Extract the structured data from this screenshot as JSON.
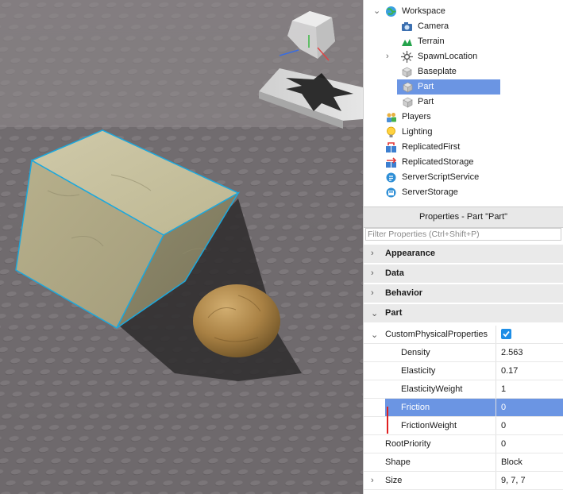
{
  "explorer": {
    "items": [
      {
        "label": "Workspace",
        "icon": "workspace-globe-icon",
        "expanded": true
      },
      {
        "label": "Camera",
        "icon": "camera-icon"
      },
      {
        "label": "Terrain",
        "icon": "terrain-icon"
      },
      {
        "label": "SpawnLocation",
        "icon": "spawn-location-icon",
        "collapsed_expander": true
      },
      {
        "label": "Baseplate",
        "icon": "part-block-icon"
      },
      {
        "label": "Part",
        "icon": "part-block-icon",
        "selected": true
      },
      {
        "label": "Part",
        "icon": "part-block-icon"
      },
      {
        "label": "Players",
        "icon": "players-icon"
      },
      {
        "label": "Lighting",
        "icon": "lighting-bulb-icon"
      },
      {
        "label": "ReplicatedFirst",
        "icon": "replicated-first-icon"
      },
      {
        "label": "ReplicatedStorage",
        "icon": "replicated-storage-icon"
      },
      {
        "label": "ServerScriptService",
        "icon": "server-script-service-icon"
      },
      {
        "label": "ServerStorage",
        "icon": "server-storage-icon"
      }
    ]
  },
  "properties": {
    "title": "Properties - Part \"Part\"",
    "filter_placeholder": "Filter Properties (Ctrl+Shift+P)",
    "categories": [
      {
        "label": "Appearance",
        "expanded": false
      },
      {
        "label": "Data",
        "expanded": false
      },
      {
        "label": "Behavior",
        "expanded": false
      },
      {
        "label": "Part",
        "expanded": true
      }
    ],
    "rows": [
      {
        "name": "CustomPhysicalProperties",
        "value": "",
        "checkbox": true,
        "checked": true,
        "expanded": true
      },
      {
        "name": "Density",
        "value": "2.563"
      },
      {
        "name": "Elasticity",
        "value": "0.17"
      },
      {
        "name": "ElasticityWeight",
        "value": "1"
      },
      {
        "name": "Friction",
        "value": "0",
        "selected": true
      },
      {
        "name": "FrictionWeight",
        "value": "0"
      },
      {
        "name": "RootPriority",
        "value": "0"
      },
      {
        "name": "Shape",
        "value": "Block"
      },
      {
        "name": "Size",
        "value": "9, 7, 7",
        "expander": true
      }
    ]
  },
  "colors": {
    "selection": "#6b95e3",
    "checkbox": "#1e8ee6",
    "annotation_mark": "#e02020",
    "viewport_floor": "#6f6a6d"
  }
}
